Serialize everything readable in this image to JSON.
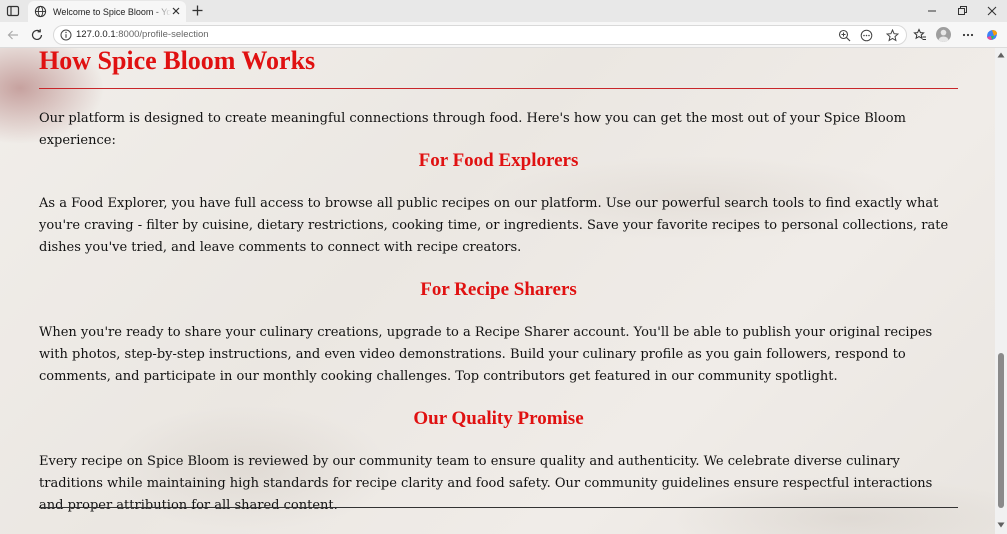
{
  "browser": {
    "tab_title": "Welcome to Spice Bloom - Your Culinary Journey",
    "url_host": "127.0.0.1",
    "url_path": ":8000/profile-selection"
  },
  "page": {
    "title": "How Spice Bloom Works",
    "intro": "Our platform is designed to create meaningful connections through food. Here's how you can get the most out of your Spice Bloom experience:",
    "sections": [
      {
        "heading": "For Food Explorers",
        "body": "As a Food Explorer, you have full access to browse all public recipes on our platform. Use our powerful search tools to find exactly what you're craving - filter by cuisine, dietary restrictions, cooking time, or ingredients. Save your favorite recipes to personal collections, rate dishes you've tried, and leave comments to connect with recipe creators."
      },
      {
        "heading": "For Recipe Sharers",
        "body": "When you're ready to share your culinary creations, upgrade to a Recipe Sharer account. You'll be able to publish your original recipes with photos, step-by-step instructions, and even video demonstrations. Build your culinary profile as you gain followers, respond to comments, and participate in our monthly cooking challenges. Top contributors get featured in our community spotlight."
      },
      {
        "heading": "Our Quality Promise",
        "body": "Every recipe on Spice Bloom is reviewed by our community team to ensure quality and authenticity. We celebrate diverse culinary traditions while maintaining high standards for recipe clarity and food safety. Our community guidelines ensure respectful interactions and proper attribution for all shared content."
      }
    ]
  },
  "colors": {
    "accent": "#e01111",
    "text": "#111111"
  }
}
